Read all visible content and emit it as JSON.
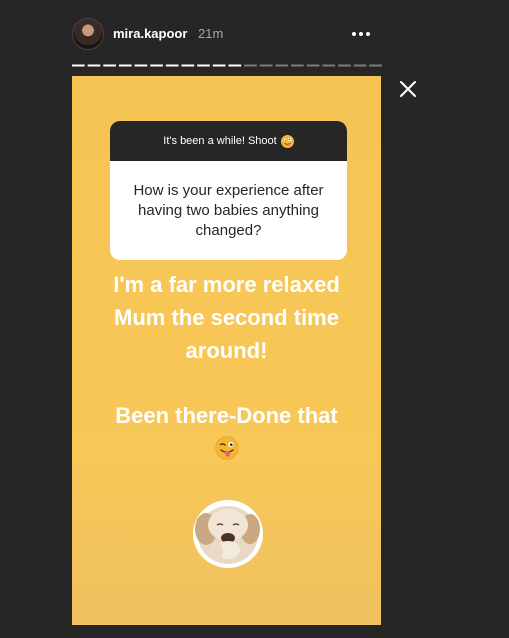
{
  "header": {
    "username": "mira.kapoor",
    "time": "21m"
  },
  "story": {
    "progress_segments": 20,
    "progress_viewed": 11,
    "question_box": {
      "title": "It's been a while! Shoot",
      "title_emoji": "goofy-face",
      "question": "How is your experience after having two babies anything changed?"
    },
    "answer_lines": [
      "I'm a far more relaxed",
      "Mum the second time",
      "around!",
      "Been there-Done that"
    ],
    "answer_emoji": "winking-face-with-tongue",
    "sticker": "puppy-sticker",
    "background_color": "#f6c453"
  },
  "colors": {
    "app_bg": "#262626",
    "accent_yellow": "#f6c453",
    "question_header_bg": "#262626"
  }
}
